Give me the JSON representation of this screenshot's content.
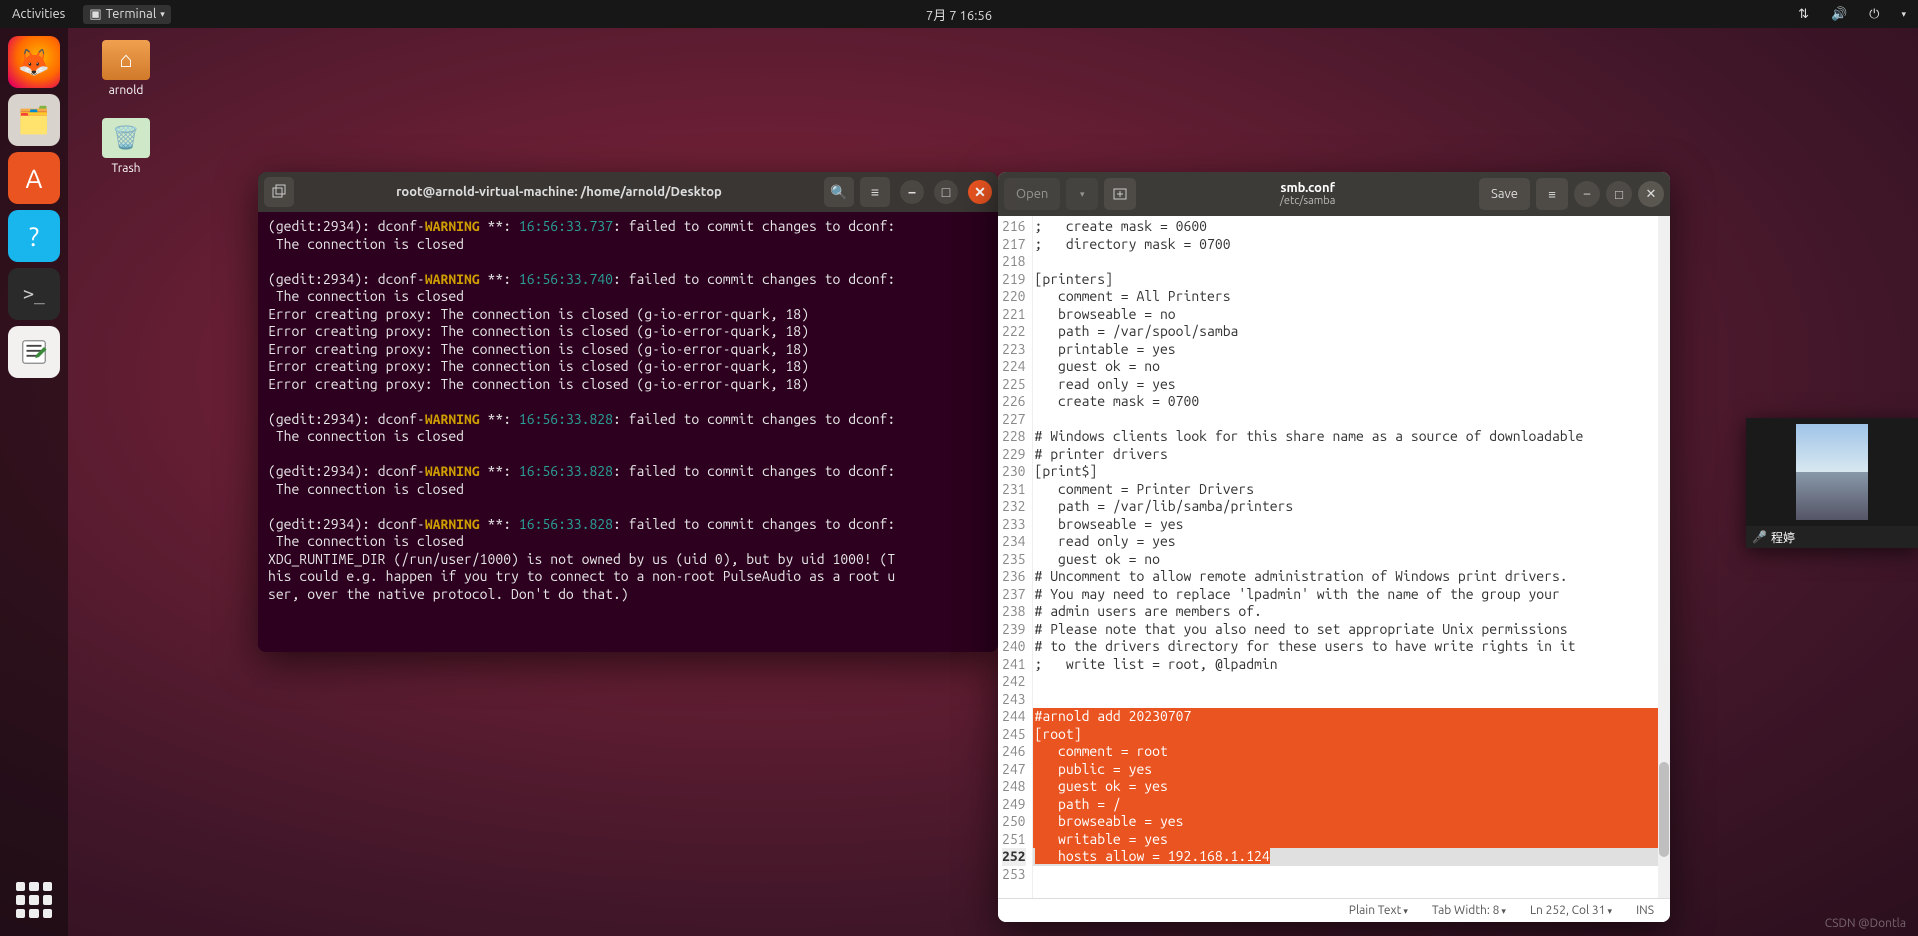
{
  "topbar": {
    "activities": "Activities",
    "app_menu": "Terminal",
    "clock": "7月 7 16:56"
  },
  "dock": {
    "tips": [
      "Firefox",
      "Files",
      "Ubuntu Software",
      "Help",
      "Terminal",
      "Text Editor",
      "Show Applications"
    ]
  },
  "desktop": {
    "icon1": "arnold",
    "icon2": "Trash"
  },
  "terminal": {
    "title": "root@arnold-virtual-machine: /home/arnold/Desktop",
    "lines": [
      {
        "type": "warn",
        "prefix": "(gedit:2934): dconf-",
        "warn": "WARNING",
        "mid": " **: ",
        "time": "16:56:33.737",
        "rest": ": failed to commit changes to dconf:"
      },
      {
        "type": "plain",
        "text": " The connection is closed"
      },
      {
        "type": "blank"
      },
      {
        "type": "warn",
        "prefix": "(gedit:2934): dconf-",
        "warn": "WARNING",
        "mid": " **: ",
        "time": "16:56:33.740",
        "rest": ": failed to commit changes to dconf:"
      },
      {
        "type": "plain",
        "text": " The connection is closed"
      },
      {
        "type": "plain",
        "text": "Error creating proxy: The connection is closed (g-io-error-quark, 18)"
      },
      {
        "type": "plain",
        "text": "Error creating proxy: The connection is closed (g-io-error-quark, 18)"
      },
      {
        "type": "plain",
        "text": "Error creating proxy: The connection is closed (g-io-error-quark, 18)"
      },
      {
        "type": "plain",
        "text": "Error creating proxy: The connection is closed (g-io-error-quark, 18)"
      },
      {
        "type": "plain",
        "text": "Error creating proxy: The connection is closed (g-io-error-quark, 18)"
      },
      {
        "type": "blank"
      },
      {
        "type": "warn",
        "prefix": "(gedit:2934): dconf-",
        "warn": "WARNING",
        "mid": " **: ",
        "time": "16:56:33.828",
        "rest": ": failed to commit changes to dconf:"
      },
      {
        "type": "plain",
        "text": " The connection is closed"
      },
      {
        "type": "blank"
      },
      {
        "type": "warn",
        "prefix": "(gedit:2934): dconf-",
        "warn": "WARNING",
        "mid": " **: ",
        "time": "16:56:33.828",
        "rest": ": failed to commit changes to dconf:"
      },
      {
        "type": "plain",
        "text": " The connection is closed"
      },
      {
        "type": "blank"
      },
      {
        "type": "warn",
        "prefix": "(gedit:2934): dconf-",
        "warn": "WARNING",
        "mid": " **: ",
        "time": "16:56:33.828",
        "rest": ": failed to commit changes to dconf:"
      },
      {
        "type": "plain",
        "text": " The connection is closed"
      },
      {
        "type": "plain",
        "text": "XDG_RUNTIME_DIR (/run/user/1000) is not owned by us (uid 0), but by uid 1000! (T"
      },
      {
        "type": "plain",
        "text": "his could e.g. happen if you try to connect to a non-root PulseAudio as a root u"
      },
      {
        "type": "plain",
        "text": "ser, over the native protocol. Don't do that.)"
      }
    ]
  },
  "gedit": {
    "open_label": "Open",
    "save_label": "Save",
    "title": "smb.conf",
    "subpath": "/etc/samba",
    "status": {
      "syntax": "Plain Text",
      "tab": "Tab Width: 8",
      "pos": "Ln 252, Col 31",
      "ins": "INS"
    },
    "first_line_no": 216,
    "cursor_line": 252,
    "lines": [
      ";   create mask = 0600",
      ";   directory mask = 0700",
      "",
      "[printers]",
      "   comment = All Printers",
      "   browseable = no",
      "   path = /var/spool/samba",
      "   printable = yes",
      "   guest ok = no",
      "   read only = yes",
      "   create mask = 0700",
      "",
      "# Windows clients look for this share name as a source of downloadable",
      "# printer drivers",
      "[print$]",
      "   comment = Printer Drivers",
      "   path = /var/lib/samba/printers",
      "   browseable = yes",
      "   read only = yes",
      "   guest ok = no",
      "# Uncomment to allow remote administration of Windows print drivers.",
      "# You may need to replace 'lpadmin' with the name of the group your",
      "# admin users are members of.",
      "# Please note that you also need to set appropriate Unix permissions",
      "# to the drivers directory for these users to have write rights in it",
      ";   write list = root, @lpadmin",
      "",
      "",
      "#arnold add 20230707",
      "[root]",
      "   comment = root",
      "   public = yes",
      "   guest ok = yes",
      "   path = /",
      "   browseable = yes",
      "   writable = yes",
      "   hosts allow = 192.168.1.124",
      ""
    ],
    "selection_from_rel": 28,
    "selection_to_rel": 36
  },
  "overlay": {
    "name_label": "程婷"
  },
  "watermark": "CSDN @Dontla"
}
